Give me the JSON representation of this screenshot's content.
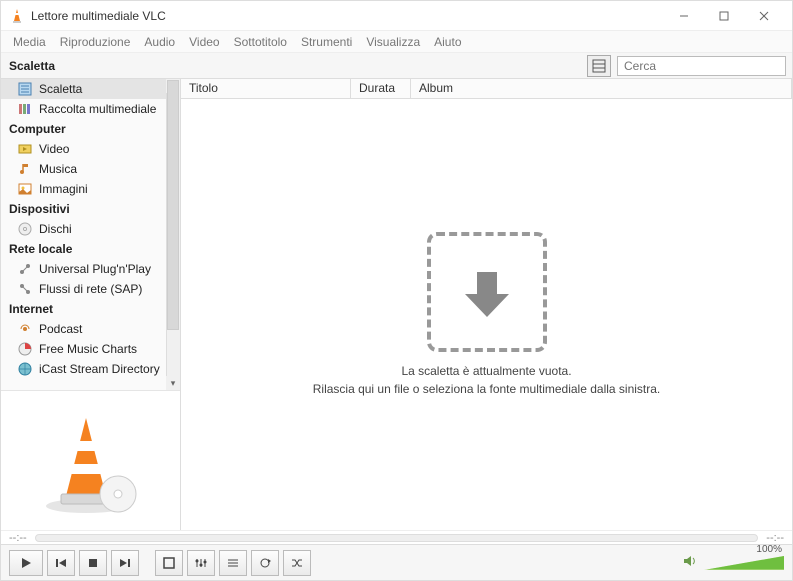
{
  "titlebar": {
    "title": "Lettore multimediale VLC"
  },
  "menu": [
    "Media",
    "Riproduzione",
    "Audio",
    "Video",
    "Sottotitolo",
    "Strumenti",
    "Visualizza",
    "Aiuto"
  ],
  "topbar": {
    "label": "Scaletta",
    "search_placeholder": "Cerca"
  },
  "sidebar": {
    "groups": [
      {
        "label": "",
        "items": [
          {
            "label": "Scaletta",
            "icon": "playlist",
            "sel": true
          },
          {
            "label": "Raccolta multimediale",
            "icon": "library"
          }
        ]
      },
      {
        "label": "Computer",
        "items": [
          {
            "label": "Video",
            "icon": "video"
          },
          {
            "label": "Musica",
            "icon": "music"
          },
          {
            "label": "Immagini",
            "icon": "images"
          }
        ]
      },
      {
        "label": "Dispositivi",
        "items": [
          {
            "label": "Dischi",
            "icon": "disc"
          }
        ]
      },
      {
        "label": "Rete locale",
        "items": [
          {
            "label": "Universal Plug'n'Play",
            "icon": "upnp"
          },
          {
            "label": "Flussi di rete (SAP)",
            "icon": "sap"
          }
        ]
      },
      {
        "label": "Internet",
        "items": [
          {
            "label": "Podcast",
            "icon": "podcast"
          },
          {
            "label": "Free Music Charts",
            "icon": "charts"
          },
          {
            "label": "iCast Stream Directory",
            "icon": "icast"
          }
        ]
      }
    ]
  },
  "columns": {
    "c1": "Titolo",
    "c2": "Durata",
    "c3": "Album"
  },
  "drop": {
    "line1": "La scaletta è attualmente vuota.",
    "line2": "Rilascia qui un file o seleziona la fonte multimediale dalla sinistra."
  },
  "time": {
    "elapsed": "--:--",
    "total": "--:--"
  },
  "volume": {
    "pct": "100%"
  }
}
